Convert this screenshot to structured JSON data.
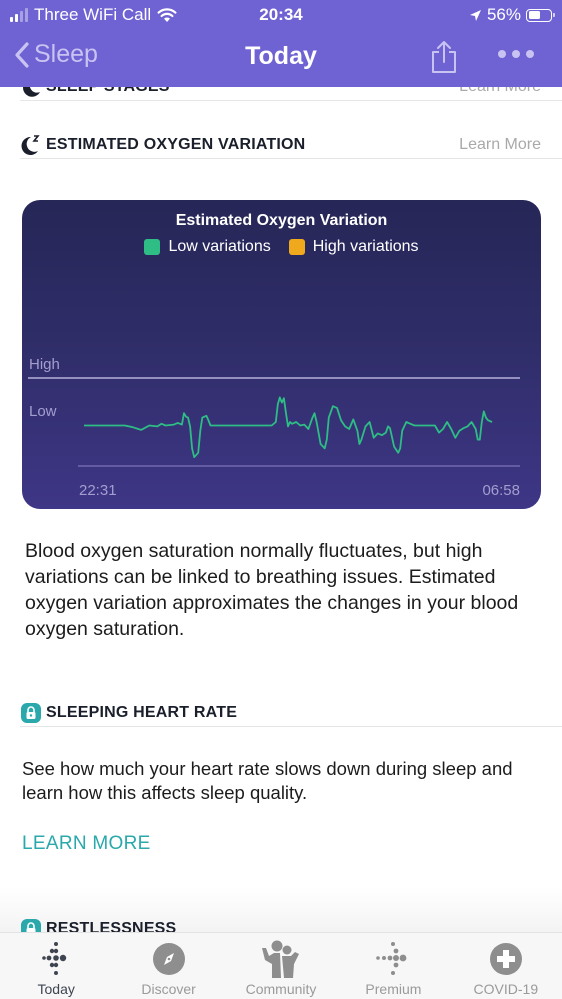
{
  "status_bar": {
    "carrier": "Three WiFi Call",
    "time": "20:34",
    "battery_percent": "56%",
    "battery_level": 0.56,
    "icons": [
      "signal-icon",
      "wifi-icon",
      "location-arrow-icon",
      "battery-icon"
    ]
  },
  "nav": {
    "back_label": "Sleep",
    "title": "Today",
    "share_icon": "share-icon",
    "more_icon": "more-dots-icon"
  },
  "sections": {
    "sleep_stages": {
      "title": "SLEEP STAGES",
      "learn_more": "Learn More",
      "icon": "moon-icon"
    },
    "oxygen": {
      "title": "ESTIMATED OXYGEN VARIATION",
      "learn_more": "Learn More",
      "icon": "moon-zz-icon"
    },
    "heart_rate": {
      "title": "SLEEPING HEART RATE",
      "icon": "lock-icon",
      "description": "See how much your heart rate slows down during sleep and learn how this affects sleep quality.",
      "learn_more": "LEARN MORE"
    },
    "restlessness": {
      "title": "RESTLESSNESS",
      "icon": "lock-icon"
    }
  },
  "oxygen_description": "Blood oxygen saturation normally fluctuates, but high variations can be linked to breathing issues. Estimated oxygen variation approximates the changes in your blood oxygen saturation.",
  "colors": {
    "brand_purple": "#6f62d3",
    "low_variation": "#2ebd84",
    "high_variation": "#f0a81c",
    "teal_link": "#2aa8ab"
  },
  "chart_data": {
    "type": "line",
    "title": "Estimated Oxygen Variation",
    "legend": [
      {
        "name": "Low variations",
        "color": "#2ebd84"
      },
      {
        "name": "High variations",
        "color": "#f0a81c"
      }
    ],
    "legend_position": "top-center",
    "xlabel": "",
    "ylabel": "",
    "x_tick_labels": [
      "22:31",
      "06:58"
    ],
    "y_tick_labels": [
      "Low",
      "High"
    ],
    "ylim": [
      0,
      1
    ],
    "y_levels": {
      "High": 1.0,
      "Low": 0.5
    },
    "grid": true,
    "series": [
      {
        "name": "Low variations",
        "x": [
          0,
          0.02,
          0.05,
          0.08,
          0.1,
          0.12,
          0.14,
          0.16,
          0.18,
          0.19,
          0.2,
          0.22,
          0.23,
          0.24,
          0.245,
          0.25,
          0.255,
          0.26,
          0.265,
          0.27,
          0.28,
          0.285,
          0.29,
          0.3,
          0.305,
          0.31,
          0.32,
          0.33,
          0.335,
          0.34,
          0.36,
          0.4,
          0.44,
          0.46,
          0.47,
          0.475,
          0.48,
          0.485,
          0.49,
          0.495,
          0.5,
          0.505,
          0.51,
          0.52,
          0.53,
          0.54,
          0.55,
          0.56,
          0.565,
          0.57,
          0.58,
          0.59,
          0.595,
          0.6,
          0.61,
          0.62,
          0.63,
          0.64,
          0.65,
          0.66,
          0.67,
          0.675,
          0.68,
          0.69,
          0.7,
          0.71,
          0.72,
          0.73,
          0.74,
          0.745,
          0.75,
          0.76,
          0.77,
          0.775,
          0.78,
          0.79,
          0.8,
          0.81,
          0.82,
          0.84,
          0.86,
          0.87,
          0.88,
          0.89,
          0.9,
          0.91,
          0.92,
          0.93,
          0.94,
          0.95,
          0.96,
          0.965,
          0.97,
          0.975,
          0.98,
          0.985,
          0.99,
          1.0
        ],
        "values": [
          0.46,
          0.46,
          0.46,
          0.46,
          0.46,
          0.44,
          0.41,
          0.46,
          0.45,
          0.48,
          0.46,
          0.47,
          0.49,
          0.47,
          0.6,
          0.56,
          0.55,
          0.45,
          0.2,
          0.1,
          0.15,
          0.4,
          0.55,
          0.57,
          0.52,
          0.46,
          0.46,
          0.46,
          0.46,
          0.46,
          0.46,
          0.46,
          0.46,
          0.46,
          0.5,
          0.7,
          0.78,
          0.72,
          0.77,
          0.6,
          0.45,
          0.5,
          0.48,
          0.5,
          0.46,
          0.47,
          0.42,
          0.55,
          0.6,
          0.5,
          0.25,
          0.2,
          0.3,
          0.55,
          0.68,
          0.66,
          0.52,
          0.45,
          0.42,
          0.53,
          0.4,
          0.25,
          0.3,
          0.45,
          0.5,
          0.32,
          0.37,
          0.35,
          0.38,
          0.45,
          0.43,
          0.22,
          0.15,
          0.2,
          0.4,
          0.5,
          0.48,
          0.46,
          0.46,
          0.46,
          0.46,
          0.38,
          0.42,
          0.5,
          0.42,
          0.32,
          0.4,
          0.43,
          0.45,
          0.5,
          0.42,
          0.3,
          0.3,
          0.5,
          0.62,
          0.55,
          0.52,
          0.5
        ]
      }
    ]
  },
  "tabs": [
    {
      "label": "Today",
      "icon": "fitbit-dots-icon",
      "active": true
    },
    {
      "label": "Discover",
      "icon": "compass-icon",
      "active": false
    },
    {
      "label": "Community",
      "icon": "community-people-icon",
      "active": false
    },
    {
      "label": "Premium",
      "icon": "premium-dots-icon",
      "active": false
    },
    {
      "label": "COVID-19",
      "icon": "medical-cross-icon",
      "active": false
    }
  ]
}
